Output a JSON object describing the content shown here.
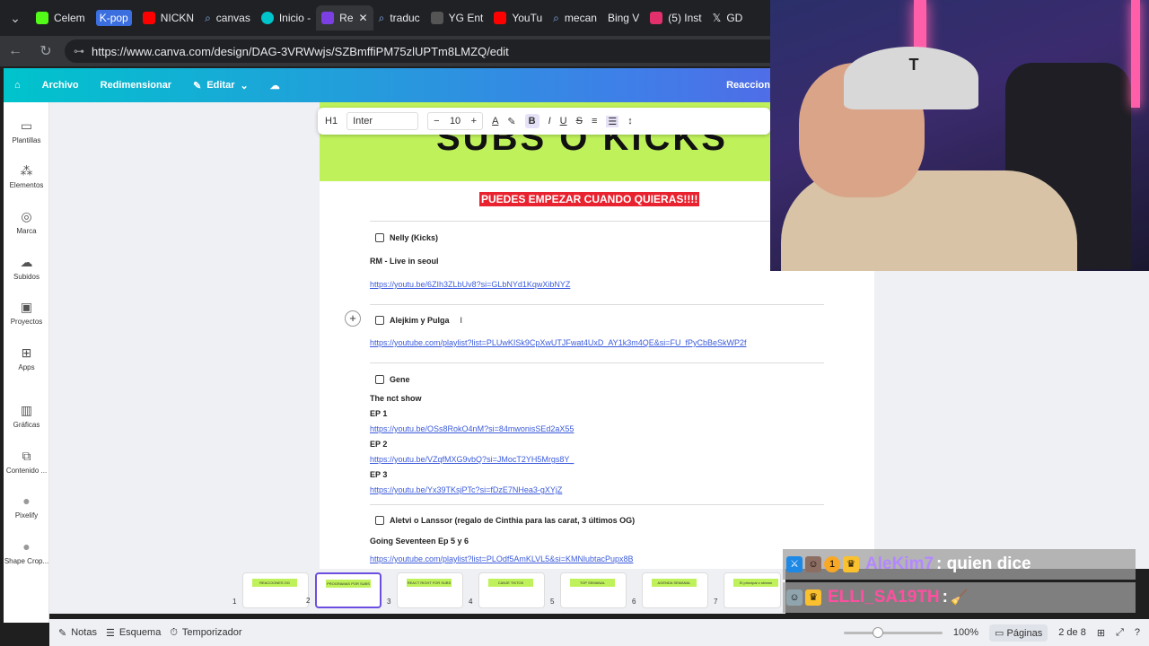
{
  "browser": {
    "tabs": [
      {
        "label": "Celem",
        "fav_color": "#53fc18"
      },
      {
        "label": "K-pop",
        "fav_color": "#3b6fe0"
      },
      {
        "label": "NICKN",
        "fav_color": "#ff0000"
      },
      {
        "label": "canvas",
        "fav_color": "#8ab4f8"
      },
      {
        "label": "Inicio -",
        "fav_color": "#00c4cc"
      },
      {
        "label": "Re",
        "fav_color": "#7b3fe4"
      },
      {
        "label": "traduc",
        "fav_color": "#8ab4f8"
      },
      {
        "label": "YG Ent",
        "fav_color": "#555555"
      },
      {
        "label": "YouTu",
        "fav_color": "#ff0000"
      },
      {
        "label": "mecan",
        "fav_color": "#8ab4f8"
      },
      {
        "label": "Bing V",
        "fav_color": "#555555"
      },
      {
        "label": "(5) Inst",
        "fav_color": "#e1306c"
      },
      {
        "label": "GD",
        "fav_color": "#555555"
      }
    ],
    "url": "https://www.canva.com/design/DAG-3VRWwjs/SZBmffiPM75zlUPTm8LMZQ/edit"
  },
  "header": {
    "archivo": "Archivo",
    "redimensionar": "Redimensionar",
    "editar": "Editar",
    "right_label": "Reaccion"
  },
  "sidebar": {
    "items": [
      {
        "label": "Plantillas",
        "icon": "▭"
      },
      {
        "label": "Elementos",
        "icon": "⁂"
      },
      {
        "label": "Marca",
        "icon": "◎"
      },
      {
        "label": "Subidos",
        "icon": "☁"
      },
      {
        "label": "Proyectos",
        "icon": "▣"
      },
      {
        "label": "Apps",
        "icon": "⊞"
      },
      {
        "label": "Gráficas",
        "icon": "▥"
      },
      {
        "label": "Contenido ...",
        "icon": "⧉"
      },
      {
        "label": "Pixelify",
        "icon": "●"
      },
      {
        "label": "Shape Crop...",
        "icon": "●"
      }
    ]
  },
  "toolbar": {
    "heading": "H1",
    "font": "Inter",
    "size_minus": "−",
    "size": "10",
    "size_plus": "+",
    "bold": "B",
    "italic": "I",
    "underline": "U",
    "strike": "S"
  },
  "page": {
    "title": "SUBS O KICKS",
    "banner": "PUEDES EMPEZAR CUANDO QUIERAS!!!!",
    "blocks": {
      "b1_check": "Nelly (Kicks)",
      "b1_line": "RM - Live in seoul",
      "b1_link": "https://youtu.be/6ZIh3ZLbUv8?si=GLbNYd1KqwXibNYZ",
      "b2_check": "Alejkim y Pulga",
      "b2_link": "https://youtube.com/playlist?list=PLUwKISk9CpXwUTJFwat4UxD_AY1k3m4QE&si=FU_fPyCbBeSkWP2f",
      "b3_check": "Gene",
      "b3_line": "The nct show",
      "b3_ep1": "EP 1",
      "b3_link1": "https://youtu.be/OSs8RokO4nM?si=84mwonisSEd2aX55",
      "b3_ep2": "EP 2",
      "b3_link2": "https://youtu.be/VZqfMXG9vbQ?si=JMocT2YH5Mrgs8Y_",
      "b3_ep3": "EP 3",
      "b3_link3": "https://youtu.be/Yx39TKsjPTc?si=fDzE7NHea3-gXYjZ",
      "b4_check": "Aletvi o Lanssor (regalo de Cinthia para las carat, 3 últimos OG)",
      "b4_line": "Going Seventeen Ep 5 y 6",
      "b4_link": "https://youtube.com/playlist?list=PLOdf5AmKLVL5&si=KMNlubtacPupx8B"
    }
  },
  "thumbnails": [
    {
      "num": "1",
      "label": "REACCIONES OG"
    },
    {
      "num": "2",
      "label": "PROGRAMAS POR SUBS O KICKS"
    },
    {
      "num": "3",
      "label": "REACT RIGHT FOR SUBS O KICKS"
    },
    {
      "num": "4",
      "label": "CANJE TIKTOK"
    },
    {
      "num": "5",
      "label": "TOP SEMANAL"
    },
    {
      "num": "6",
      "label": "AGENDA SEMANAL"
    },
    {
      "num": "7",
      "label": "El principal o stream"
    }
  ],
  "bottombar": {
    "notas": "Notas",
    "esquema": "Esquema",
    "temporizador": "Temporizador",
    "zoom": "100%",
    "zoom_fraction": 0.35,
    "paginas": "Páginas",
    "page_counter": "2 de 8"
  },
  "chat": [
    {
      "user": "AleKim7",
      "user_color": "#b388ff",
      "message": ": quien dice"
    },
    {
      "user": "ELLI_SA19TH",
      "user_color": "#ff4fa0",
      "message": ":"
    }
  ],
  "colors": {
    "accent": "#7b3fe4",
    "page_header": "#bff25a",
    "banner": "#e8232f",
    "link": "#3b5bdb"
  }
}
